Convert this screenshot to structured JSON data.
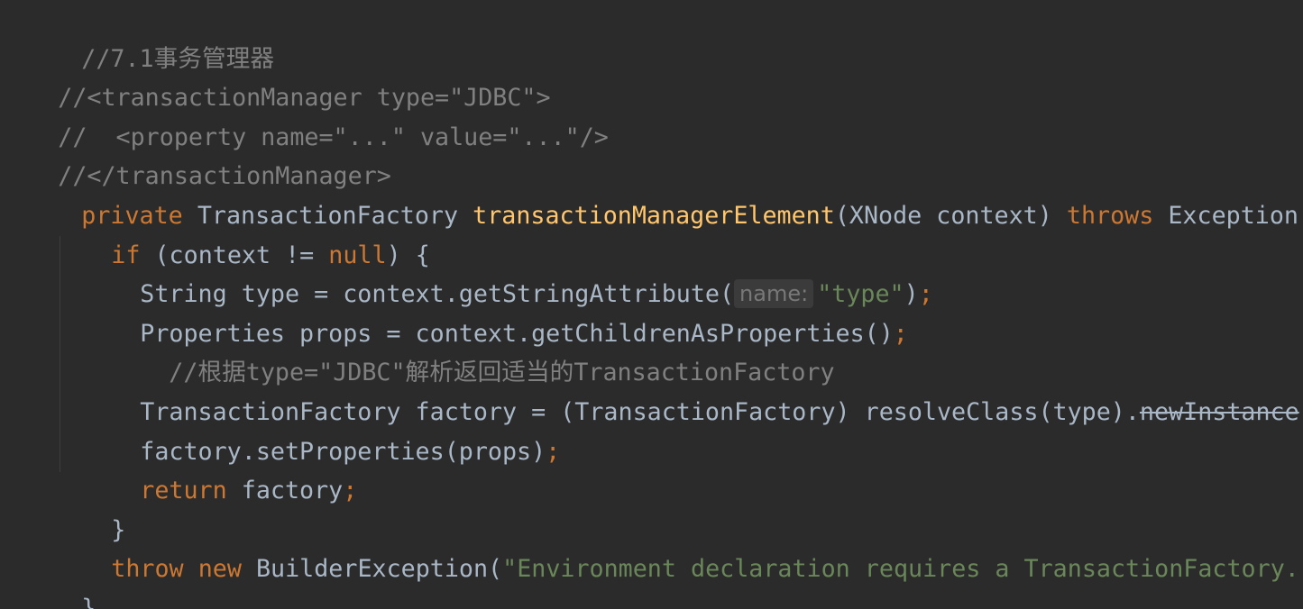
{
  "colors": {
    "background": "#2b2b2b",
    "default_text": "#a9b7c6",
    "comment": "#808080",
    "keyword": "#cc7832",
    "string": "#6a8759",
    "method_declaration": "#ffc66d",
    "param_hint_bg": "#3b3b3b"
  },
  "code": {
    "l1": {
      "comment": "//7.1事务管理器"
    },
    "l2": {
      "comment": "//<transactionManager type=\"JDBC\">"
    },
    "l3": {
      "comment": "//  <property name=\"...\" value=\"...\"/>"
    },
    "l4": {
      "comment": "//</transactionManager>"
    },
    "l5": {
      "kw_private": "private",
      "type": " TransactionFactory ",
      "method": "transactionManagerElement",
      "params": "(XNode context) ",
      "kw_throws": "throws",
      "rest": " Exception {"
    },
    "l6": {
      "kw_if": "if",
      "mid": " (context != ",
      "kw_null": "null",
      "rest": ") {"
    },
    "l7": {
      "pre": "String type = context.getStringAttribute(",
      "hint": "name:",
      "str": "\"type\"",
      "close": ")",
      "semi": ";"
    },
    "l8": {
      "text": "Properties props = context.getChildrenAsProperties()",
      "semi": ";"
    },
    "l9": {
      "comment": "//根据type=\"JDBC\"解析返回适当的TransactionFactory"
    },
    "l10": {
      "pre": "TransactionFactory factory = (TransactionFactory) resolveClass(type).",
      "deprecated": "newInstance",
      "post": "()",
      "semi": ";"
    },
    "l11": {
      "text": "factory.setProperties(props)",
      "semi": ";"
    },
    "l12": {
      "kw_return": "return",
      "text": " factory",
      "semi": ";"
    },
    "l13": {
      "brace": "}"
    },
    "l14": {
      "kw_throw": "throw",
      "kw_new": " new",
      "pre": " BuilderException(",
      "str": "\"Environment declaration requires a TransactionFactory.\"",
      "close": ")",
      "semi": ";"
    },
    "l15": {
      "brace": "}"
    }
  }
}
